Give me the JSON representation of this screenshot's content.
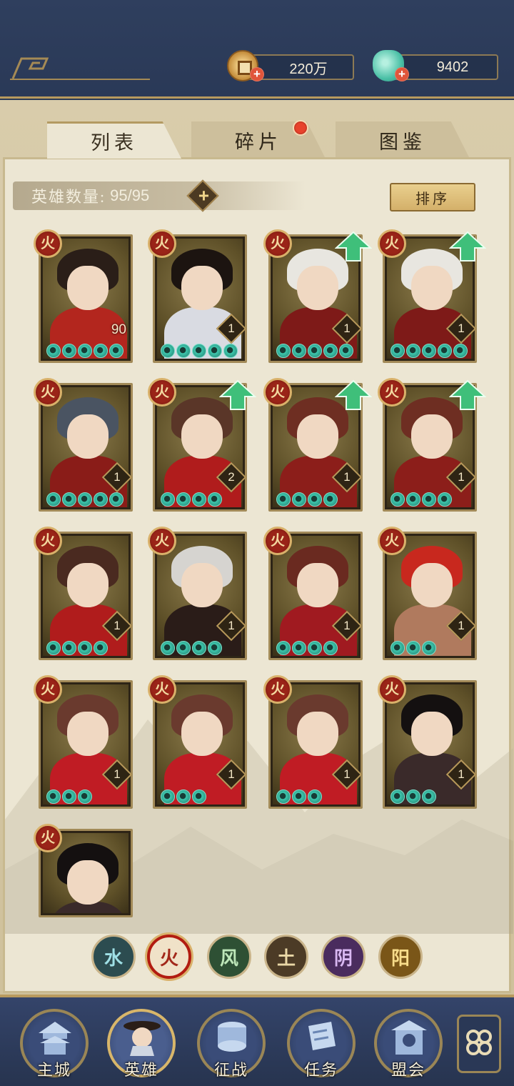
{
  "currency": {
    "coins": "220万",
    "jade": "9402"
  },
  "tabs": [
    "列表",
    "碎片",
    "图鉴"
  ],
  "hero_count": {
    "label": "英雄数量:",
    "value": "95/95"
  },
  "sort_label": "排序",
  "heroes": [
    {
      "element": "火",
      "level": "90",
      "stars": 5,
      "upgrade": false
    },
    {
      "element": "火",
      "level": "1",
      "stars": 5,
      "upgrade": false
    },
    {
      "element": "火",
      "level": "1",
      "stars": 5,
      "upgrade": true
    },
    {
      "element": "火",
      "level": "1",
      "stars": 5,
      "upgrade": true
    },
    {
      "element": "火",
      "level": "1",
      "stars": 5,
      "upgrade": false
    },
    {
      "element": "火",
      "level": "2",
      "stars": 4,
      "upgrade": true
    },
    {
      "element": "火",
      "level": "1",
      "stars": 4,
      "upgrade": true
    },
    {
      "element": "火",
      "level": "1",
      "stars": 4,
      "upgrade": true
    },
    {
      "element": "火",
      "level": "1",
      "stars": 4,
      "upgrade": false
    },
    {
      "element": "火",
      "level": "1",
      "stars": 4,
      "upgrade": false
    },
    {
      "element": "火",
      "level": "1",
      "stars": 4,
      "upgrade": false
    },
    {
      "element": "火",
      "level": "1",
      "stars": 3,
      "upgrade": false
    },
    {
      "element": "火",
      "level": "1",
      "stars": 3,
      "upgrade": false
    },
    {
      "element": "火",
      "level": "1",
      "stars": 3,
      "upgrade": false
    },
    {
      "element": "火",
      "level": "1",
      "stars": 3,
      "upgrade": false
    },
    {
      "element": "火",
      "level": "1",
      "stars": 3,
      "upgrade": false
    },
    {
      "element": "火",
      "level": "",
      "stars": 0,
      "upgrade": false
    }
  ],
  "element_filters": [
    "水",
    "火",
    "风",
    "土",
    "阴",
    "阳"
  ],
  "nav": [
    "主城",
    "英雄",
    "征战",
    "任务",
    "盟会"
  ],
  "colors": {
    "header_bg": "#2f3f5e",
    "parchment": "#ece6d3",
    "gold_border": "#b89a5e",
    "fire_red": "#9a2418",
    "star_jade": "#3ec8ae"
  }
}
